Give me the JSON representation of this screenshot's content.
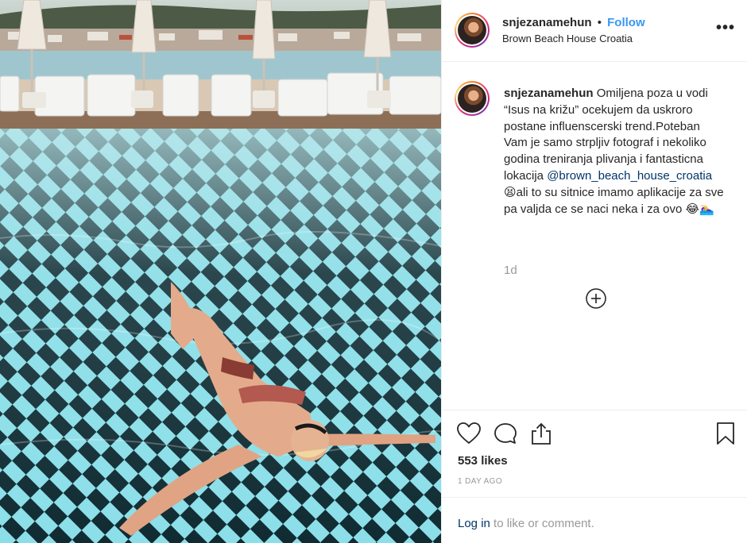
{
  "post": {
    "username": "snjezanamehun",
    "follow_label": "Follow",
    "separator": "•",
    "location": "Brown Beach House Croatia",
    "more_label": "•••"
  },
  "caption": {
    "username": "snjezanamehun",
    "text_before": "Omiljena poza u vodi “Isus na križu” ocekujem da uskroro postane influenscerski trend.Poteban Vam je samo strpljiv fotograf i nekoliko godina treniranja plivanja i fantasticna lokacija",
    "mention": "@brown_beach_house_croatia",
    "text_after": "😫ali to su sitnice imamo aplikacije za sve pa valjda ce se naci neka i za ovo 😂🏊‍♀️",
    "time_ago": "1d"
  },
  "actions": {
    "likes": "553 likes",
    "date": "1 DAY AGO",
    "icons": [
      "heart-icon",
      "comment-icon",
      "share-icon",
      "bookmark-icon"
    ]
  },
  "login": {
    "link": "Log in",
    "rest": " to like or comment."
  },
  "colors": {
    "link_blue": "#3897f0",
    "mention_blue": "#003569",
    "muted": "#999999",
    "border": "#efefef"
  }
}
